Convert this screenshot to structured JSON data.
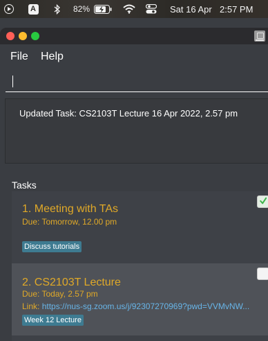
{
  "menubar": {
    "icons": [
      "play-icon",
      "input-source-icon",
      "bluetooth-icon",
      "battery-icon",
      "wifi-icon",
      "control-center-icon"
    ],
    "input_source": "A",
    "battery_percent": "82%",
    "date": "Sat 16 Apr",
    "time": "2:57 PM"
  },
  "window": {
    "controls": [
      "close",
      "minimize",
      "maximize"
    ]
  },
  "app_menu": {
    "file": "File",
    "help": "Help"
  },
  "command_box": {
    "value": ""
  },
  "result": {
    "text": "Updated Task: CS2103T Lecture 16 Apr 2022, 2.57 pm"
  },
  "tasks": {
    "title": "Tasks",
    "items": [
      {
        "title": "1.  Meeting with TAs",
        "due": "Due: Tomorrow, 12.00 pm",
        "tag": "Discuss tutorials",
        "done": true
      },
      {
        "title": "2.  CS2103T Lecture",
        "due": "Due: Today, 2.57 pm",
        "link_label": "Link: ",
        "link_url": "https://nus-sg.zoom.us/j/92307270969?pwd=VVMvNW...",
        "tag": "Week 12 Lecture",
        "done": false
      }
    ]
  },
  "colors": {
    "background": "#3a3d42",
    "accent_title": "#e0a928",
    "link": "#68b5e8",
    "tag_bg": "#3e7b91",
    "check_green": "#3db34a"
  }
}
